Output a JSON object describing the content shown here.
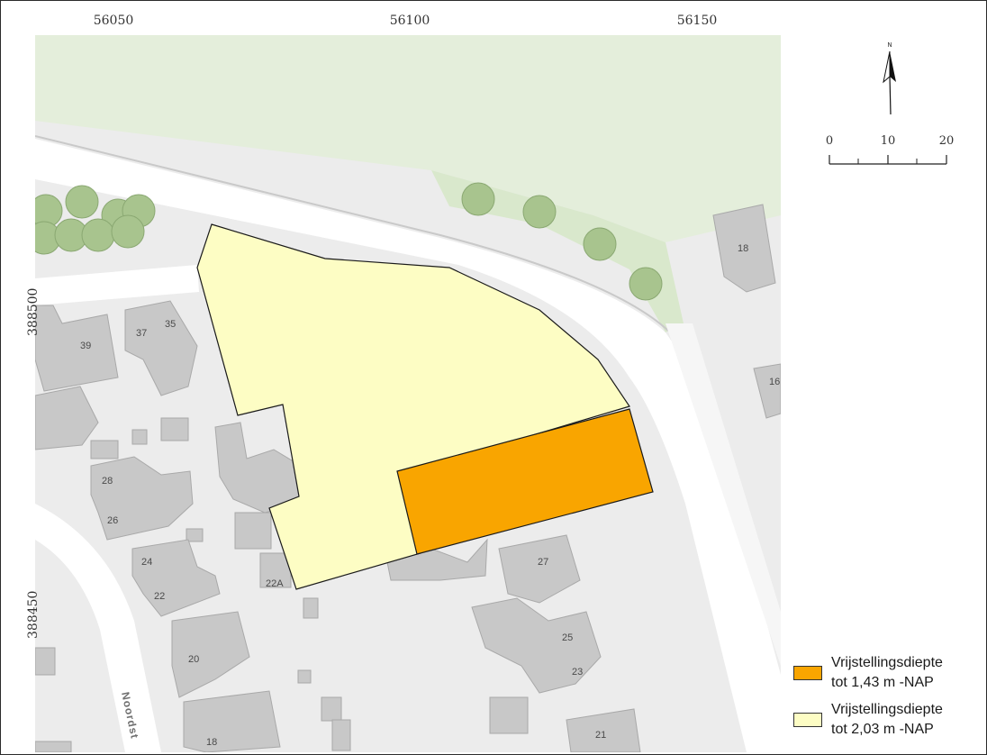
{
  "map": {
    "x_ticks": [
      "56050",
      "56100",
      "56150"
    ],
    "y_ticks": [
      "388500",
      "388450"
    ],
    "street_label": "Noordst",
    "north_label": "N",
    "scale_labels": [
      "0",
      "10",
      "20"
    ]
  },
  "buildings": [
    {
      "label": "39"
    },
    {
      "label": "37"
    },
    {
      "label": "35"
    },
    {
      "label": "28"
    },
    {
      "label": "26"
    },
    {
      "label": "24"
    },
    {
      "label": "22"
    },
    {
      "label": "22A"
    },
    {
      "label": "20"
    },
    {
      "label": "18"
    },
    {
      "label": "27"
    },
    {
      "label": "25"
    },
    {
      "label": "23"
    },
    {
      "label": "21"
    },
    {
      "label": "18"
    },
    {
      "label": "16"
    }
  ],
  "legend": [
    {
      "line1": "Vrijstellingsdiepte",
      "line2": "tot 1,43 m -NAP",
      "color": "#f9a500"
    },
    {
      "line1": "Vrijstellingsdiepte",
      "line2": "tot 2,03 m -NAP",
      "color": "#fdfdc4"
    }
  ]
}
